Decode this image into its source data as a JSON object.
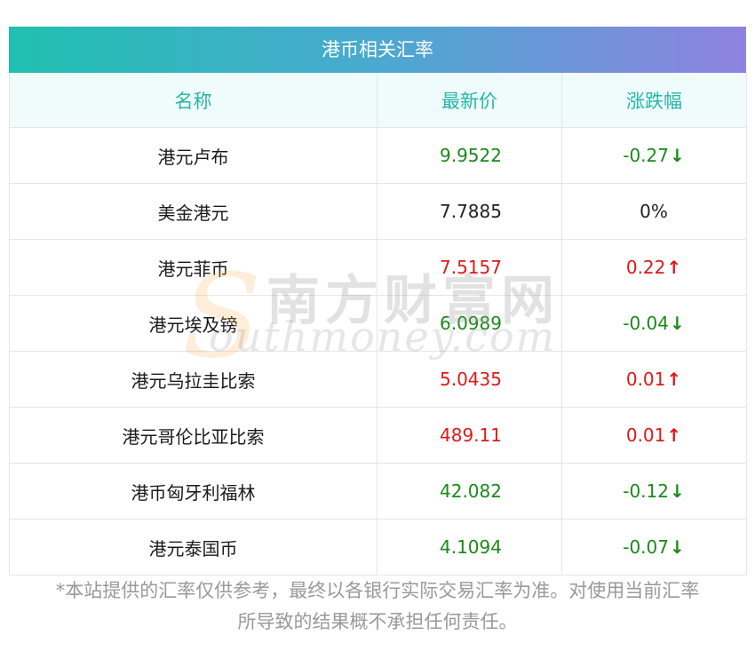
{
  "title": "港币相关汇率",
  "columns": {
    "name": "名称",
    "price": "最新价",
    "change": "涨跌幅"
  },
  "rows": [
    {
      "name": "港元卢布",
      "price": "9.9522",
      "change": "-0.27",
      "arrow": "↓",
      "status": "green"
    },
    {
      "name": "美金港元",
      "price": "7.7885",
      "change": "0%",
      "arrow": "",
      "status": "black"
    },
    {
      "name": "港元菲币",
      "price": "7.5157",
      "change": "0.22",
      "arrow": "↑",
      "status": "red"
    },
    {
      "name": "港元埃及镑",
      "price": "6.0989",
      "change": "-0.04",
      "arrow": "↓",
      "status": "green"
    },
    {
      "name": "港元乌拉圭比索",
      "price": "5.0435",
      "change": "0.01",
      "arrow": "↑",
      "status": "red"
    },
    {
      "name": "港元哥伦比亚比索",
      "price": "489.11",
      "change": "0.01",
      "arrow": "↑",
      "status": "red"
    },
    {
      "name": "港币匈牙利福林",
      "price": "42.082",
      "change": "-0.12",
      "arrow": "↓",
      "status": "green"
    },
    {
      "name": "港元泰国币",
      "price": "4.1094",
      "change": "-0.07",
      "arrow": "↓",
      "status": "green"
    }
  ],
  "watermark": {
    "s": "S",
    "cn": "南方财富网",
    "en": "outhmoney.com"
  },
  "disclaimer": {
    "line1": "*本站提供的汇率仅供参考，最终以各银行实际交易汇率为准。对使用当前汇率",
    "line2": "所导致的结果概不承担任何责任。"
  },
  "colors": {
    "up": "#e01818",
    "down": "#1a8a1a",
    "flat": "#222222",
    "header_text": "#25b6a9",
    "gradient_start": "#20c0b0",
    "gradient_end": "#8f82e0"
  }
}
